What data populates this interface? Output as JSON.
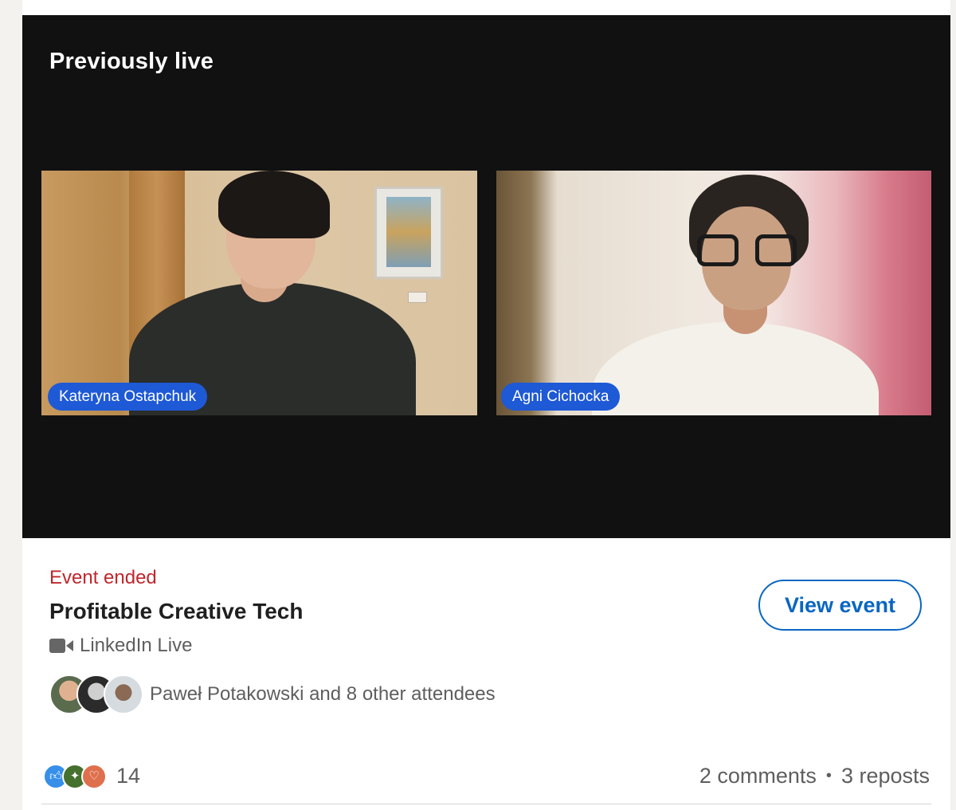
{
  "video": {
    "status_label": "Previously live",
    "speakers": [
      {
        "name": "Kateryna Ostapchuk"
      },
      {
        "name": "Agni Cichocka"
      }
    ]
  },
  "event": {
    "status": "Event ended",
    "title": "Profitable Creative Tech",
    "type_icon": "video-camera-icon",
    "type_label": "LinkedIn Live",
    "view_button": "View event",
    "attendees_text": "Paweł Potakowski and 8 other attendees"
  },
  "social": {
    "reaction_icons": [
      "like-icon",
      "celebrate-icon",
      "love-icon"
    ],
    "reaction_count": "14",
    "comments": "2 comments",
    "separator": "•",
    "reposts": "3 reposts"
  },
  "colors": {
    "accent": "#0a66c2",
    "name_pill": "#1e59d6",
    "event_ended": "#c0262d",
    "video_bg": "#111112"
  }
}
